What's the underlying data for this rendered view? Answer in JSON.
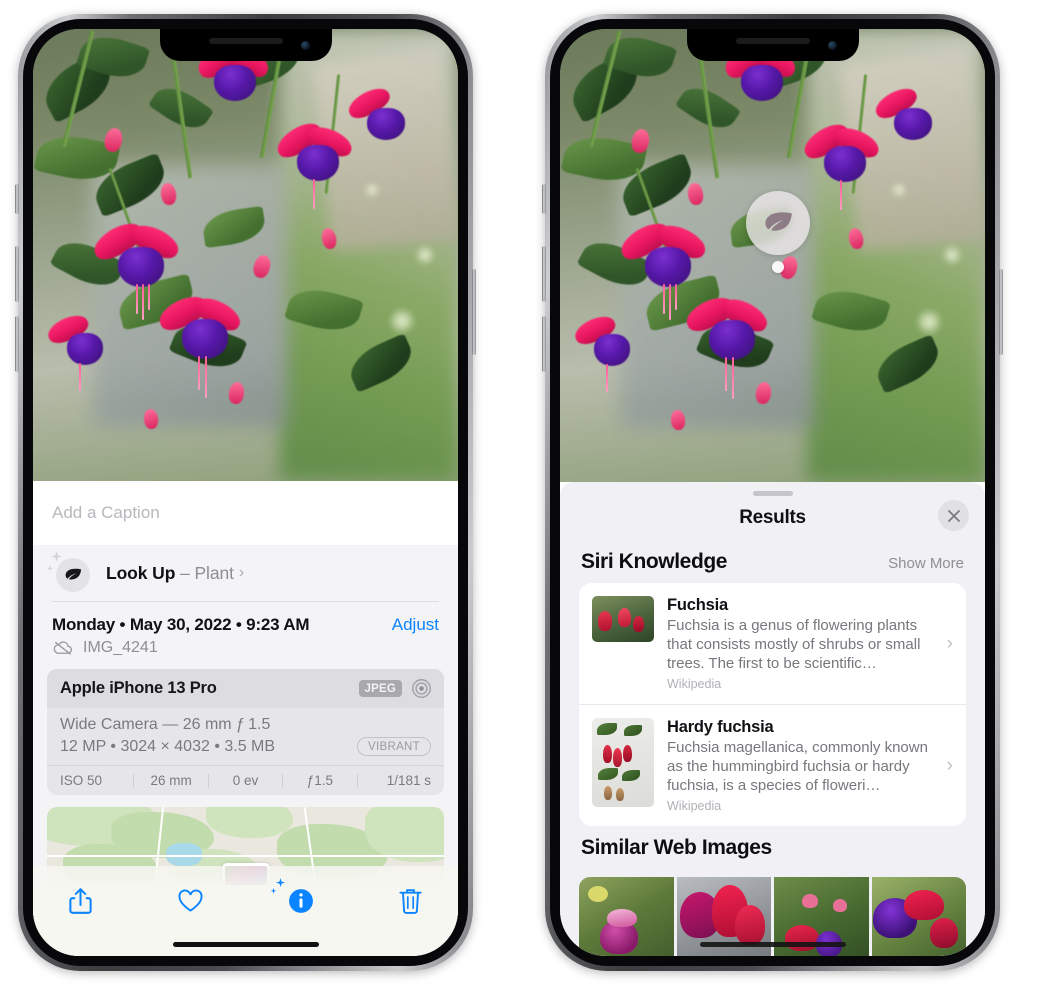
{
  "left_phone": {
    "photo": {
      "alt_name": "fuchsia-flowers-photo"
    },
    "caption_placeholder": "Add a Caption",
    "lookup": {
      "label": "Look Up",
      "dash": "–",
      "subject": "Plant",
      "chevron": "›",
      "icon": "leaf-icon"
    },
    "datetime": "Monday • May 30, 2022 • 9:23 AM",
    "adjust_label": "Adjust",
    "filename": "IMG_4241",
    "filename_icon": "cloud-slash-icon",
    "metadata": {
      "device": "Apple iPhone 13 Pro",
      "format_badge": "JPEG",
      "lens_icon": "aperture-icon",
      "lens_line": "Wide Camera — 26 mm ƒ 1.5",
      "size_line": "12 MP • 3024 × 4032 • 3.5 MB",
      "style_badge": "VIBRANT",
      "exif": [
        "ISO 50",
        "26 mm",
        "0 ev",
        "ƒ1.5",
        "1/181 s"
      ]
    },
    "toolbar": [
      {
        "name": "share-button",
        "icon": "share-icon"
      },
      {
        "name": "favorite-button",
        "icon": "heart-icon"
      },
      {
        "name": "info-button",
        "icon": "info-sparkle-icon"
      },
      {
        "name": "delete-button",
        "icon": "trash-icon"
      }
    ]
  },
  "right_phone": {
    "badge": {
      "icon": "leaf-icon",
      "name": "visual-lookup-badge"
    },
    "sheet": {
      "title": "Results",
      "close_label": "×",
      "sections": {
        "siri_knowledge": {
          "title": "Siri Knowledge",
          "action": "Show More",
          "items": [
            {
              "title": "Fuchsia",
              "description": "Fuchsia is a genus of flowering plants that consists mostly of shrubs or small trees. The first to be scientific…",
              "source": "Wikipedia",
              "chevron": "›"
            },
            {
              "title": "Hardy fuchsia",
              "description": "Fuchsia magellanica, commonly known as the hummingbird fuchsia or hardy fuchsia, is a species of floweri…",
              "source": "Wikipedia",
              "chevron": "›"
            }
          ]
        },
        "similar_web_images": {
          "title": "Similar Web Images",
          "count": 4
        }
      }
    }
  },
  "colors": {
    "accent_blue": "#0a84ff",
    "sheet_bg": "#f1f1f5",
    "card_bg": "#ffffff",
    "secondary_text": "#8e8e93"
  }
}
